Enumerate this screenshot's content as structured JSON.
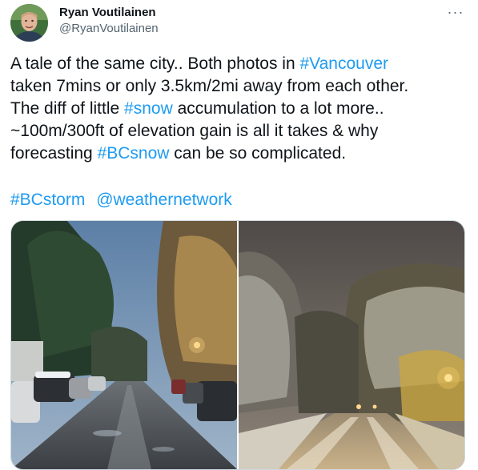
{
  "author": {
    "name": "Ryan Voutilainen",
    "handle": "@RyanVoutilainen"
  },
  "menu": {
    "more_icon": "more-horizontal-icon",
    "more_label": "···"
  },
  "tweet": {
    "line1": {
      "text": "A tale of the same city.. Both photos in ",
      "tag": "#Vancouver"
    },
    "line2": "taken 7mins or only 3.5km/2mi away from each other.",
    "line3": {
      "pre": "The diff of little ",
      "tag": "#snow",
      "post": " accumulation to a lot more.."
    },
    "line4": "~100m/300ft of elevation gain is all it takes & why",
    "line5": {
      "pre": "forecasting ",
      "tag": "#BCsnow",
      "post": " can be so complicated."
    },
    "tags": {
      "hashtag": "#BCstorm",
      "mention": "@weathernetwork"
    }
  },
  "colors": {
    "link": "#1d9bf0",
    "text": "#0f1419",
    "secondary": "#536471",
    "border": "#cfd9de"
  }
}
